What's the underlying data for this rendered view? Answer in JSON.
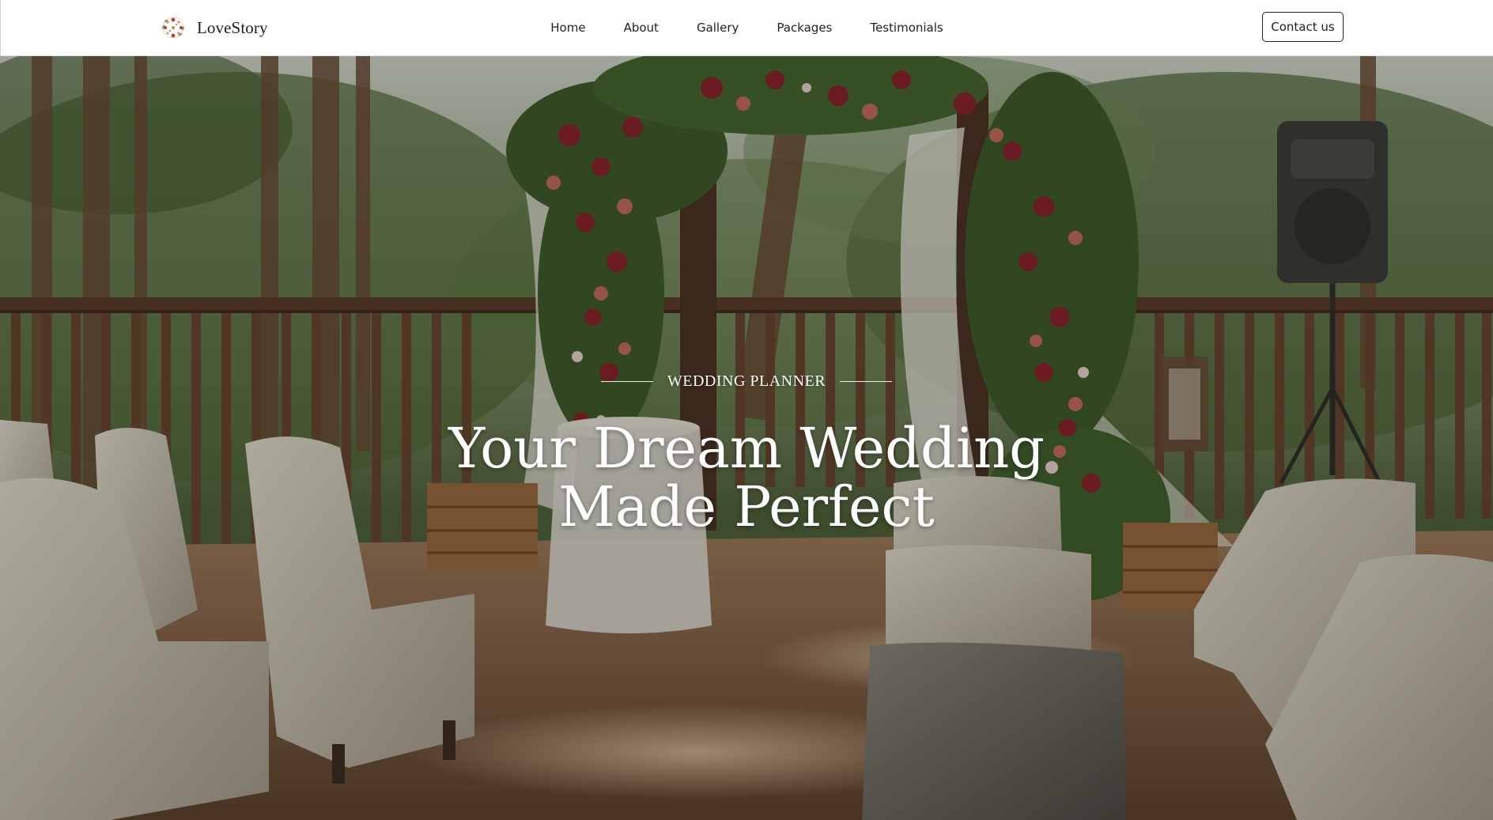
{
  "header": {
    "brand_name": "LoveStory",
    "logo_icon": "floral-wreath-logo-icon",
    "nav": [
      {
        "label": "Home"
      },
      {
        "label": "About"
      },
      {
        "label": "Gallery"
      },
      {
        "label": "Packages"
      },
      {
        "label": "Testimonials"
      }
    ],
    "contact_label": "Contact us"
  },
  "hero": {
    "eyebrow": "WEDDING PLANNER",
    "headline_line1": "Your Dream Wedding",
    "headline_line2": "Made Perfect"
  },
  "colors": {
    "text_dark": "#1e1e1e",
    "hero_text": "#ffffff",
    "flower_red": "#8b1f2a"
  }
}
